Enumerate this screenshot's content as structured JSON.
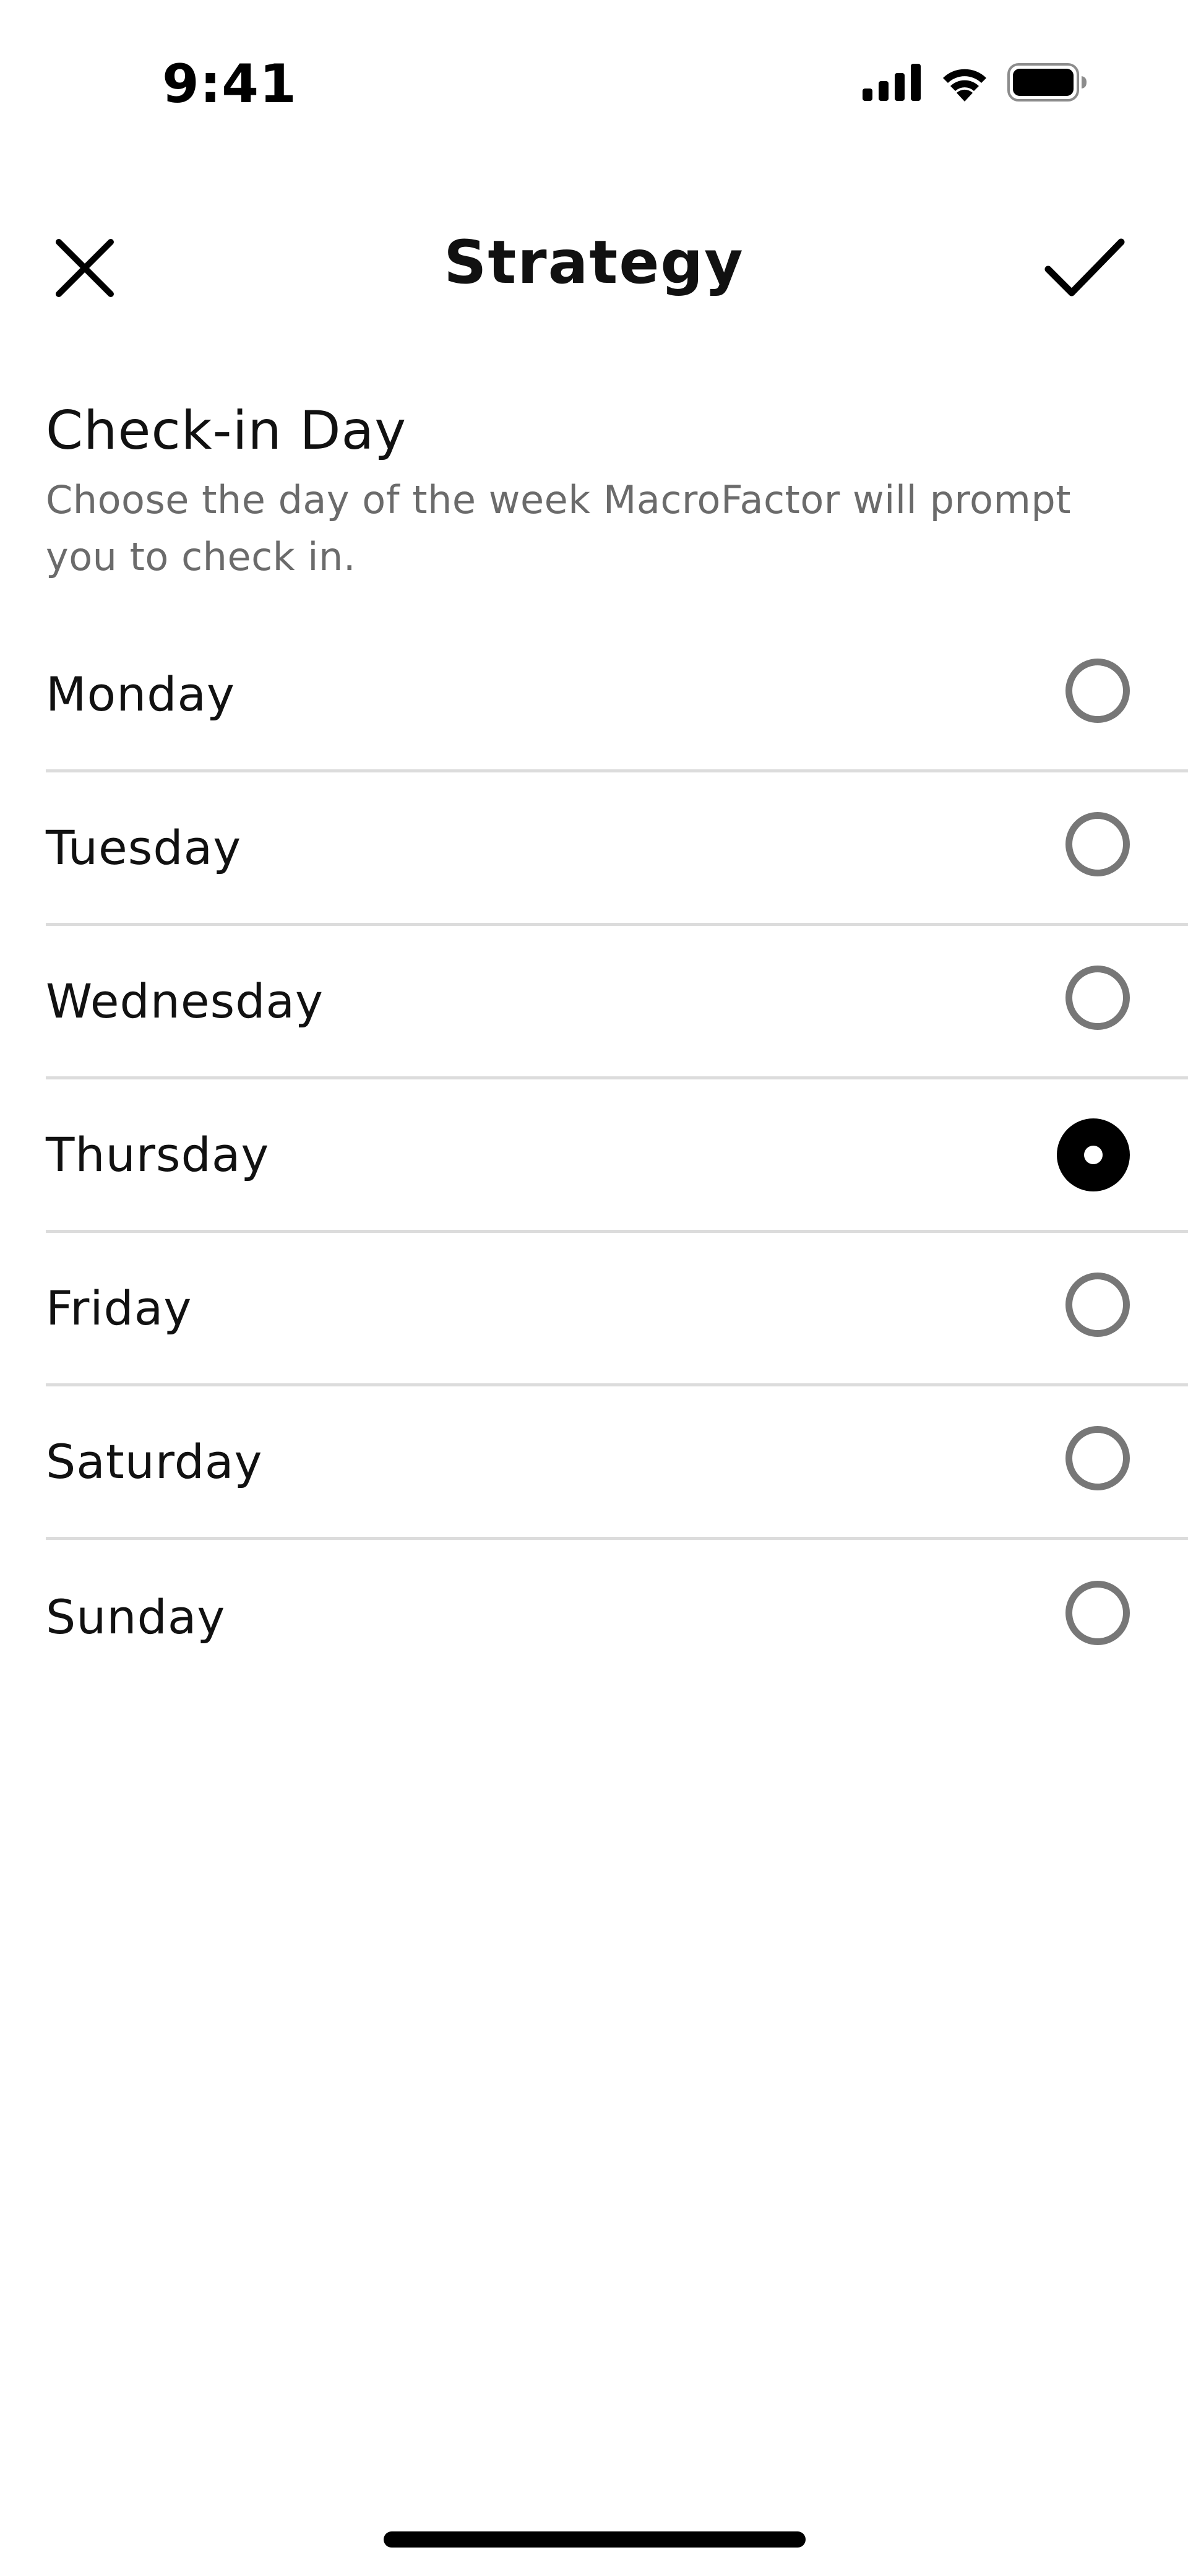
{
  "status_bar": {
    "time": "9:41",
    "icons": [
      "signal-icon",
      "wifi-icon",
      "battery-icon"
    ]
  },
  "nav": {
    "title": "Strategy",
    "close_icon": "close-icon",
    "confirm_icon": "checkmark-icon"
  },
  "section": {
    "title": "Check-in Day",
    "description": "Choose the day of the week MacroFactor will prompt you to check in."
  },
  "days": [
    {
      "label": "Monday",
      "selected": false
    },
    {
      "label": "Tuesday",
      "selected": false
    },
    {
      "label": "Wednesday",
      "selected": false
    },
    {
      "label": "Thursday",
      "selected": true
    },
    {
      "label": "Friday",
      "selected": false
    },
    {
      "label": "Saturday",
      "selected": false
    },
    {
      "label": "Sunday",
      "selected": false
    }
  ],
  "colors": {
    "text": "#111111",
    "secondary_text": "#6b6b6b",
    "divider": "#dcdcdc",
    "radio_unselected": "#777777",
    "radio_selected": "#000000"
  }
}
